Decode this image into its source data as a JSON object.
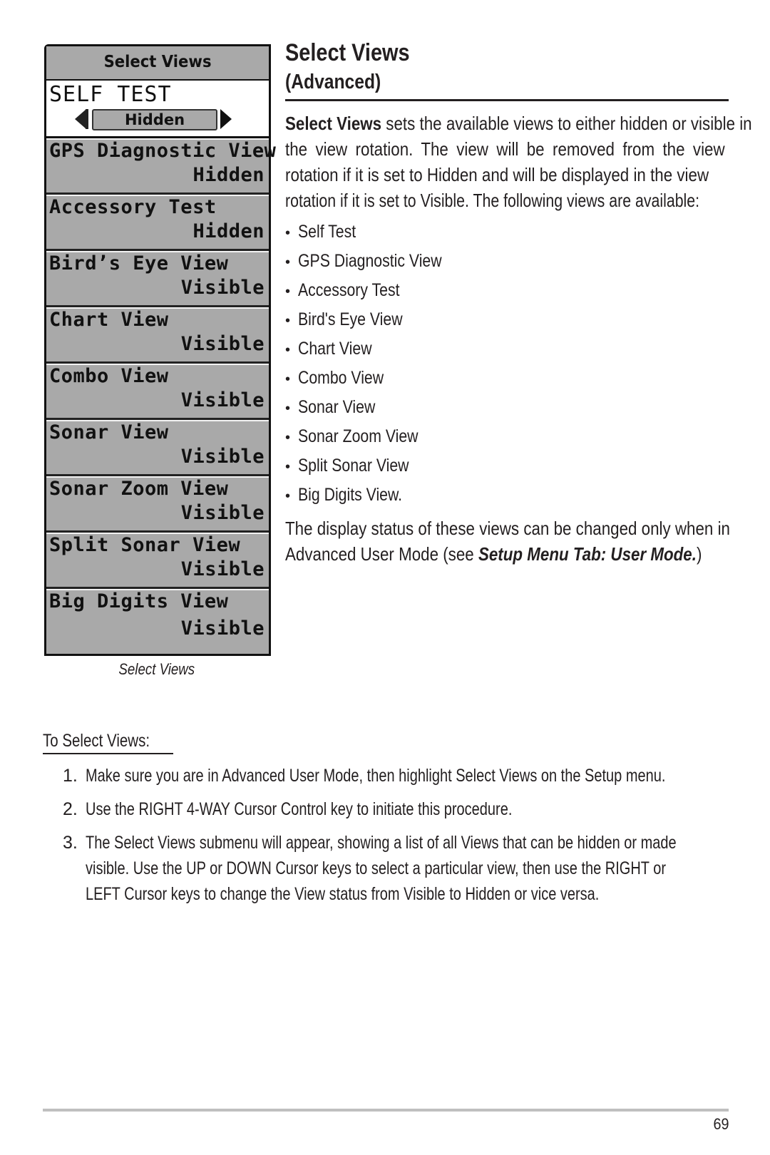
{
  "device_screen": {
    "title": "Select Views",
    "selected_item": {
      "label": "SELF TEST",
      "value": "Hidden"
    },
    "rows": [
      {
        "label": "GPS Diagnostic View",
        "value": "Hidden"
      },
      {
        "label": "Accessory Test",
        "value": "Hidden"
      },
      {
        "label": "Bird’s Eye View",
        "value": "Visible"
      },
      {
        "label": "Chart View",
        "value": "Visible"
      },
      {
        "label": "Combo View",
        "value": "Visible"
      },
      {
        "label": "Sonar View",
        "value": "Visible"
      },
      {
        "label": "Sonar Zoom View",
        "value": "Visible"
      },
      {
        "label": "Split Sonar View",
        "value": "Visible"
      },
      {
        "label": "Big Digits View",
        "value": "Visible"
      }
    ],
    "caption": "Select Views"
  },
  "section": {
    "title": "Select Views",
    "subtitle": "(Advanced)",
    "intro_bold": "Select Views",
    "intro_lines": [
      " sets the available views to either hidden or visible in",
      "the view rotation.  The view will be removed from the view",
      "rotation if it is set to Hidden and will be displayed in the view",
      "rotation if it is set to Visible. The following views are available:"
    ],
    "views_list": [
      "Self Test",
      "GPS Diagnostic View",
      "Accessory Test",
      "Bird's Eye View",
      "Chart View",
      "Combo View",
      "Sonar View",
      "Sonar Zoom View",
      "Split Sonar View",
      "Big Digits View."
    ],
    "bullet": "•",
    "note_line1": "The display status of these views can be changed only when in",
    "note_line2_prefix": "Advanced User Mode (see ",
    "note_line2_emph": "Setup Menu Tab: User Mode.",
    "note_line2_suffix": ")"
  },
  "procedure": {
    "heading": "To Select Views:",
    "steps": [
      {
        "num": "1.",
        "lines": [
          "Make sure you are in Advanced User Mode, then highlight Select Views on the Setup menu."
        ]
      },
      {
        "num": "2.",
        "lines": [
          "Use the RIGHT 4-WAY Cursor Control key to initiate this procedure."
        ]
      },
      {
        "num": "3.",
        "lines": [
          "The Select Views submenu will appear, showing a list of all Views that can be hidden or made",
          "visible. Use the UP or DOWN Cursor keys to select a particular view, then use the RIGHT or",
          "LEFT Cursor keys to change the View status from Visible to Hidden or vice versa."
        ]
      }
    ]
  },
  "footer": {
    "page_number": "69"
  }
}
